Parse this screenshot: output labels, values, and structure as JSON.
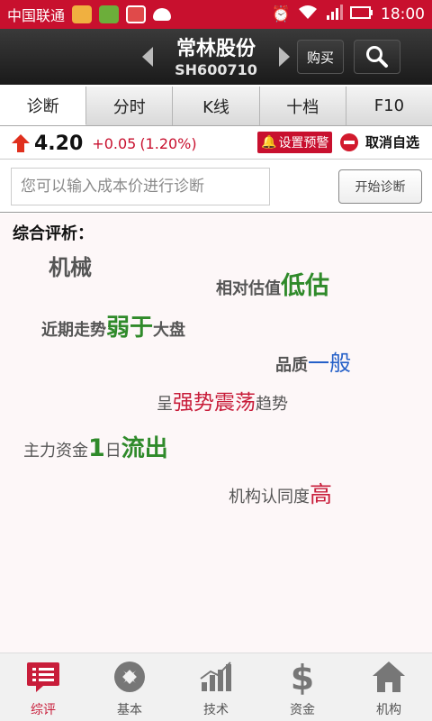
{
  "status_bar": {
    "carrier": "中国联通",
    "time": "18:00"
  },
  "header": {
    "stock_name": "常林股份",
    "stock_code": "SH600710",
    "buy_label": "购买"
  },
  "tabs": [
    {
      "label": "诊断",
      "active": true
    },
    {
      "label": "分时",
      "active": false
    },
    {
      "label": "K线",
      "active": false
    },
    {
      "label": "十档",
      "active": false
    },
    {
      "label": "F10",
      "active": false
    }
  ],
  "quote": {
    "price": "4.20",
    "change": "+0.05",
    "change_pct": "(1.20%)",
    "alert_label": "设置预警",
    "unwatch_label": "取消自选"
  },
  "diagnosis_input": {
    "placeholder": "您可以输入成本价进行诊断",
    "start_label": "开始诊断"
  },
  "analysis": {
    "heading": "综合评析：",
    "sector": "机械",
    "valuation_prefix": "相对估值",
    "valuation_value": "低估",
    "trend_prefix": "近期走势",
    "trend_value": "弱于",
    "trend_suffix": "大盘",
    "quality_prefix": "品质",
    "quality_value": "一般",
    "pattern_prefix": "呈",
    "pattern_value": "强势震荡",
    "pattern_suffix": "趋势",
    "capital_prefix": "主力资金",
    "capital_days": "1",
    "capital_day_unit": "日",
    "capital_value": "流出",
    "institution_prefix": "机构认同度",
    "institution_value": "高"
  },
  "bottom_nav": [
    {
      "label": "综评",
      "icon": "list-chat-icon",
      "active": true
    },
    {
      "label": "基本",
      "icon": "coin-icon",
      "active": false
    },
    {
      "label": "技术",
      "icon": "bar-chart-icon",
      "active": false
    },
    {
      "label": "资金",
      "icon": "dollar-icon",
      "active": false
    },
    {
      "label": "机构",
      "icon": "home-icon",
      "active": false
    }
  ],
  "colors": {
    "brand_red": "#c8102e",
    "green": "#2f8a2a",
    "blue": "#2560c8"
  }
}
